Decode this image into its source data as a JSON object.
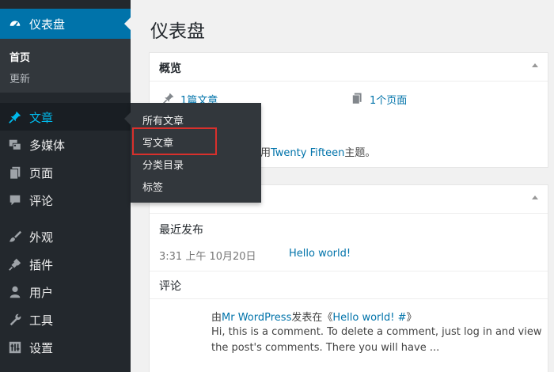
{
  "sidebar": {
    "dashboard": {
      "label": "仪表盘",
      "icon": "dashboard-icon"
    },
    "sub_items": [
      {
        "label": "首页",
        "current": true
      },
      {
        "label": "更新",
        "current": false
      }
    ],
    "items": [
      {
        "label": "文章",
        "icon": "pin-icon"
      },
      {
        "label": "多媒体",
        "icon": "media-icon"
      },
      {
        "label": "页面",
        "icon": "pages-icon"
      },
      {
        "label": "评论",
        "icon": "comment-icon"
      },
      {
        "label": "外观",
        "icon": "appearance-icon"
      },
      {
        "label": "插件",
        "icon": "plugin-icon"
      },
      {
        "label": "用户",
        "icon": "users-icon"
      },
      {
        "label": "工具",
        "icon": "tools-icon"
      },
      {
        "label": "设置",
        "icon": "settings-icon"
      }
    ]
  },
  "flyout": {
    "items": [
      "所有文章",
      "写文章",
      "分类目录",
      "标签"
    ]
  },
  "main": {
    "title": "仪表盘",
    "glance": {
      "title": "概览",
      "posts_link": "1篇文章",
      "pages_link": "1个页面",
      "theme_prefix": "用",
      "theme_name": "Twenty Fifteen",
      "theme_suffix": "主题。"
    },
    "activity": {
      "recent_title": "最近发布",
      "post_time": "3:31 上午 10月20日",
      "post_link": "Hello world!",
      "comments_title": "评论",
      "comment_prefix": "由",
      "comment_author": "Mr WordPress",
      "comment_mid": "发表在《",
      "comment_post": "Hello world! #",
      "comment_end": "》",
      "comment_line1": "Hi, this is a comment. To delete a comment, just log in and view",
      "comment_line2": "the post's comments. There you will have ..."
    }
  },
  "colors": {
    "sidebar_bg": "#23282d",
    "active_blue": "#0073aa",
    "link_blue": "#0073aa",
    "highlight_red": "#d9302c"
  }
}
